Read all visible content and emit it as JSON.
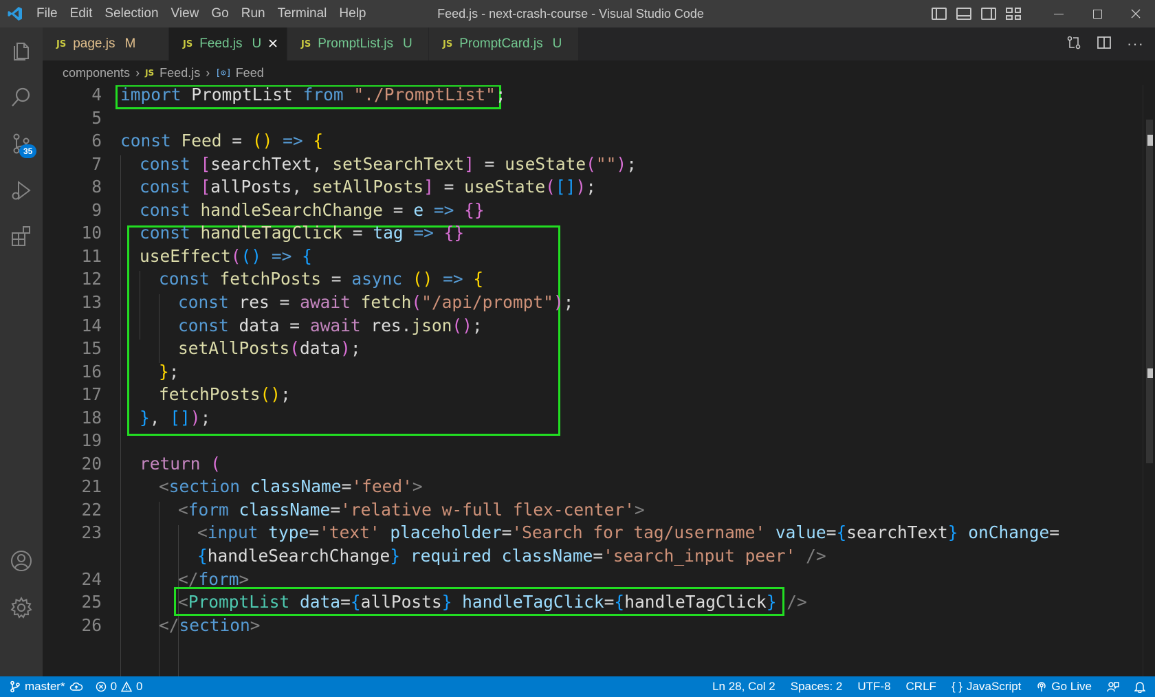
{
  "window": {
    "title": "Feed.js - next-crash-course - Visual Studio Code",
    "menu": [
      "File",
      "Edit",
      "Selection",
      "View",
      "Go",
      "Run",
      "Terminal",
      "Help"
    ]
  },
  "activity_bar": {
    "scm_badge": "35",
    "items": [
      "explorer-icon",
      "search-icon",
      "source-control-icon",
      "run-debug-icon",
      "extensions-icon",
      "accounts-icon",
      "manage-gear-icon"
    ]
  },
  "tabs": [
    {
      "icon": "JS",
      "name": "page.js",
      "state": "M",
      "kind": "modified",
      "active": false
    },
    {
      "icon": "JS",
      "name": "Feed.js",
      "state": "U",
      "kind": "untracked",
      "active": true
    },
    {
      "icon": "JS",
      "name": "PromptList.js",
      "state": "U",
      "kind": "untracked",
      "active": false
    },
    {
      "icon": "JS",
      "name": "PromptCard.js",
      "state": "U",
      "kind": "untracked",
      "active": false
    }
  ],
  "breadcrumb": {
    "folder": "components",
    "file_icon": "JS",
    "file": "Feed.js",
    "symbol": "Feed"
  },
  "editor": {
    "lines": [
      {
        "n": "4",
        "indent": 0,
        "tokens": [
          [
            "kw",
            "import"
          ],
          [
            "pn",
            " "
          ],
          [
            "id",
            "PromptList"
          ],
          [
            "pn",
            " "
          ],
          [
            "kw",
            "from"
          ],
          [
            "pn",
            " "
          ],
          [
            "str",
            "\"./PromptList\""
          ],
          [
            "pn",
            ";"
          ]
        ]
      },
      {
        "n": "5",
        "indent": 0,
        "tokens": []
      },
      {
        "n": "6",
        "indent": 0,
        "tokens": [
          [
            "kw",
            "const"
          ],
          [
            "pn",
            " "
          ],
          [
            "fn",
            "Feed"
          ],
          [
            "pn",
            " = "
          ],
          [
            "b1",
            "()"
          ],
          [
            "pn",
            " "
          ],
          [
            "kw",
            "=>"
          ],
          [
            "pn",
            " "
          ],
          [
            "b1",
            "{"
          ]
        ]
      },
      {
        "n": "7",
        "indent": 1,
        "tokens": [
          [
            "kw",
            "const"
          ],
          [
            "pn",
            " "
          ],
          [
            "b2",
            "["
          ],
          [
            "id",
            "searchText"
          ],
          [
            "pn",
            ", "
          ],
          [
            "fn",
            "setSearchText"
          ],
          [
            "b2",
            "]"
          ],
          [
            "pn",
            " = "
          ],
          [
            "fn",
            "useState"
          ],
          [
            "b2",
            "("
          ],
          [
            "str",
            "\"\""
          ],
          [
            "b2",
            ")"
          ],
          [
            "pn",
            ";"
          ]
        ]
      },
      {
        "n": "8",
        "indent": 1,
        "tokens": [
          [
            "kw",
            "const"
          ],
          [
            "pn",
            " "
          ],
          [
            "b2",
            "["
          ],
          [
            "id",
            "allPosts"
          ],
          [
            "pn",
            ", "
          ],
          [
            "fn",
            "setAllPosts"
          ],
          [
            "b2",
            "]"
          ],
          [
            "pn",
            " = "
          ],
          [
            "fn",
            "useState"
          ],
          [
            "b2",
            "("
          ],
          [
            "b3",
            "[]"
          ],
          [
            "b2",
            ")"
          ],
          [
            "pn",
            ";"
          ]
        ]
      },
      {
        "n": "9",
        "indent": 1,
        "tokens": [
          [
            "kw",
            "const"
          ],
          [
            "pn",
            " "
          ],
          [
            "fn",
            "handleSearchChange"
          ],
          [
            "pn",
            " = "
          ],
          [
            "var",
            "e"
          ],
          [
            "pn",
            " "
          ],
          [
            "kw",
            "=>"
          ],
          [
            "pn",
            " "
          ],
          [
            "b2",
            "{}"
          ]
        ]
      },
      {
        "n": "10",
        "indent": 1,
        "tokens": [
          [
            "kw",
            "const"
          ],
          [
            "pn",
            " "
          ],
          [
            "fn",
            "handleTagClick"
          ],
          [
            "pn",
            " = "
          ],
          [
            "var",
            "tag"
          ],
          [
            "pn",
            " "
          ],
          [
            "kw",
            "=>"
          ],
          [
            "pn",
            " "
          ],
          [
            "b2",
            "{}"
          ]
        ]
      },
      {
        "n": "11",
        "indent": 1,
        "tokens": [
          [
            "fn",
            "useEffect"
          ],
          [
            "b2",
            "("
          ],
          [
            "b3",
            "()"
          ],
          [
            "pn",
            " "
          ],
          [
            "kw",
            "=>"
          ],
          [
            "pn",
            " "
          ],
          [
            "b3",
            "{"
          ]
        ]
      },
      {
        "n": "12",
        "indent": 2,
        "tokens": [
          [
            "kw",
            "const"
          ],
          [
            "pn",
            " "
          ],
          [
            "fn",
            "fetchPosts"
          ],
          [
            "pn",
            " = "
          ],
          [
            "kw",
            "async"
          ],
          [
            "pn",
            " "
          ],
          [
            "b1",
            "()"
          ],
          [
            "pn",
            " "
          ],
          [
            "kw",
            "=>"
          ],
          [
            "pn",
            " "
          ],
          [
            "b1",
            "{"
          ]
        ]
      },
      {
        "n": "13",
        "indent": 3,
        "tokens": [
          [
            "kw",
            "const"
          ],
          [
            "pn",
            " "
          ],
          [
            "id",
            "res"
          ],
          [
            "pn",
            " = "
          ],
          [
            "ctl",
            "await"
          ],
          [
            "pn",
            " "
          ],
          [
            "fn",
            "fetch"
          ],
          [
            "b2",
            "("
          ],
          [
            "str",
            "\"/api/prompt\""
          ],
          [
            "b2",
            ")"
          ],
          [
            "pn",
            ";"
          ]
        ]
      },
      {
        "n": "14",
        "indent": 3,
        "tokens": [
          [
            "kw",
            "const"
          ],
          [
            "pn",
            " "
          ],
          [
            "id",
            "data"
          ],
          [
            "pn",
            " = "
          ],
          [
            "ctl",
            "await"
          ],
          [
            "pn",
            " "
          ],
          [
            "id",
            "res"
          ],
          [
            "pn",
            "."
          ],
          [
            "fn",
            "json"
          ],
          [
            "b2",
            "()"
          ],
          [
            "pn",
            ";"
          ]
        ]
      },
      {
        "n": "15",
        "indent": 3,
        "tokens": [
          [
            "fn",
            "setAllPosts"
          ],
          [
            "b2",
            "("
          ],
          [
            "id",
            "data"
          ],
          [
            "b2",
            ")"
          ],
          [
            "pn",
            ";"
          ]
        ]
      },
      {
        "n": "16",
        "indent": 2,
        "tokens": [
          [
            "b1",
            "}"
          ],
          [
            "pn",
            ";"
          ]
        ]
      },
      {
        "n": "17",
        "indent": 2,
        "tokens": [
          [
            "fn",
            "fetchPosts"
          ],
          [
            "b1",
            "()"
          ],
          [
            "pn",
            ";"
          ]
        ]
      },
      {
        "n": "18",
        "indent": 1,
        "tokens": [
          [
            "b3",
            "}"
          ],
          [
            "pn",
            ", "
          ],
          [
            "b3",
            "[]"
          ],
          [
            "b2",
            ")"
          ],
          [
            "pn",
            ";"
          ]
        ]
      },
      {
        "n": "19",
        "indent": 0,
        "tokens": []
      },
      {
        "n": "20",
        "indent": 1,
        "tokens": [
          [
            "ctl",
            "return"
          ],
          [
            "pn",
            " "
          ],
          [
            "b2",
            "("
          ]
        ]
      },
      {
        "n": "21",
        "indent": 2,
        "tokens": [
          [
            "tagb",
            "<"
          ],
          [
            "tg",
            "section"
          ],
          [
            "pn",
            " "
          ],
          [
            "attr",
            "className"
          ],
          [
            "pn",
            "="
          ],
          [
            "str",
            "'feed'"
          ],
          [
            "tagb",
            ">"
          ]
        ]
      },
      {
        "n": "22",
        "indent": 3,
        "tokens": [
          [
            "tagb",
            "<"
          ],
          [
            "tg",
            "form"
          ],
          [
            "pn",
            " "
          ],
          [
            "attr",
            "className"
          ],
          [
            "pn",
            "="
          ],
          [
            "str",
            "'relative w-full flex-center'"
          ],
          [
            "tagb",
            ">"
          ]
        ]
      },
      {
        "n": "23",
        "indent": 4,
        "tokens": [
          [
            "tagb",
            "<"
          ],
          [
            "tg",
            "input"
          ],
          [
            "pn",
            " "
          ],
          [
            "attr",
            "type"
          ],
          [
            "pn",
            "="
          ],
          [
            "str",
            "'text'"
          ],
          [
            "pn",
            " "
          ],
          [
            "attr",
            "placeholder"
          ],
          [
            "pn",
            "="
          ],
          [
            "str",
            "'Search for tag/username'"
          ],
          [
            "pn",
            " "
          ],
          [
            "attr",
            "value"
          ],
          [
            "pn",
            "="
          ],
          [
            "b3",
            "{"
          ],
          [
            "id",
            "searchText"
          ],
          [
            "b3",
            "}"
          ],
          [
            "pn",
            " "
          ],
          [
            "attr",
            "onChange"
          ],
          [
            "pn",
            "="
          ]
        ]
      },
      {
        "n": "",
        "indent": 4,
        "tokens": [
          [
            "b3",
            "{"
          ],
          [
            "id",
            "handleSearchChange"
          ],
          [
            "b3",
            "}"
          ],
          [
            "pn",
            " "
          ],
          [
            "attr",
            "required"
          ],
          [
            "pn",
            " "
          ],
          [
            "attr",
            "className"
          ],
          [
            "pn",
            "="
          ],
          [
            "str",
            "'search_input peer'"
          ],
          [
            "pn",
            " "
          ],
          [
            "tagb",
            "/>"
          ]
        ]
      },
      {
        "n": "24",
        "indent": 3,
        "tokens": [
          [
            "tagb",
            "</"
          ],
          [
            "tg",
            "form"
          ],
          [
            "tagb",
            ">"
          ]
        ]
      },
      {
        "n": "25",
        "indent": 3,
        "tokens": [
          [
            "tagb",
            "<"
          ],
          [
            "cmp",
            "PromptList"
          ],
          [
            "pn",
            " "
          ],
          [
            "attr",
            "data"
          ],
          [
            "pn",
            "="
          ],
          [
            "b3",
            "{"
          ],
          [
            "id",
            "allPosts"
          ],
          [
            "b3",
            "}"
          ],
          [
            "pn",
            " "
          ],
          [
            "attr",
            "handleTagClick"
          ],
          [
            "pn",
            "="
          ],
          [
            "b3",
            "{"
          ],
          [
            "id",
            "handleTagClick"
          ],
          [
            "b3",
            "}"
          ],
          [
            "pn",
            " "
          ],
          [
            "tagb",
            "/>"
          ]
        ]
      },
      {
        "n": "26",
        "indent": 2,
        "tokens": [
          [
            "tagb",
            "</"
          ],
          [
            "tg",
            "section"
          ],
          [
            "tagb",
            ">"
          ]
        ]
      }
    ]
  },
  "status_bar": {
    "branch": "master*",
    "errors": "0",
    "warnings": "0",
    "cursor": "Ln 28, Col 2",
    "spaces": "Spaces: 2",
    "encoding": "UTF-8",
    "eol": "CRLF",
    "language": "JavaScript",
    "go_live": "Go Live"
  }
}
